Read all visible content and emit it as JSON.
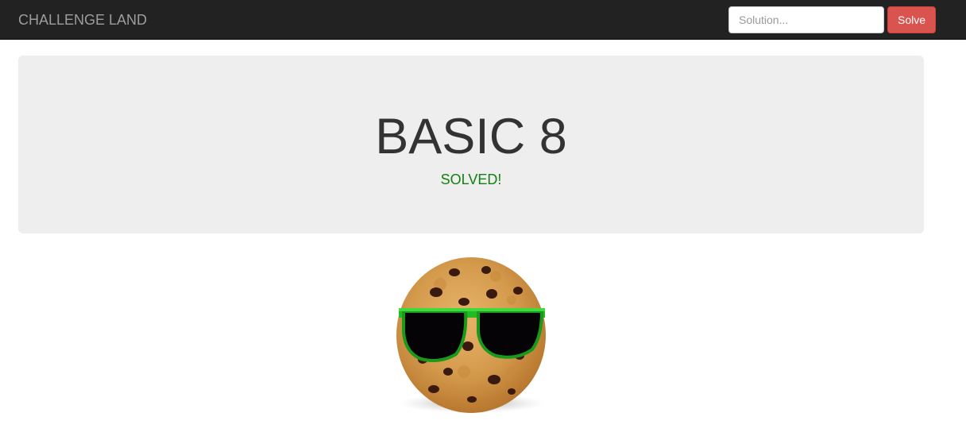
{
  "navbar": {
    "brand": "CHALLENGE LAND",
    "solution_placeholder": "Solution...",
    "solution_value": "",
    "solve_label": "Solve"
  },
  "challenge": {
    "title": "BASIC 8",
    "status": "SOLVED!"
  },
  "image": {
    "icon": "cookie-with-sunglasses"
  },
  "colors": {
    "navbar_bg": "#222222",
    "brand_text": "#9d9d9d",
    "solve_button": "#d9534f",
    "jumbotron_bg": "#eeeeee",
    "status_green": "#128012",
    "sunglasses_frame": "#22bb22"
  }
}
